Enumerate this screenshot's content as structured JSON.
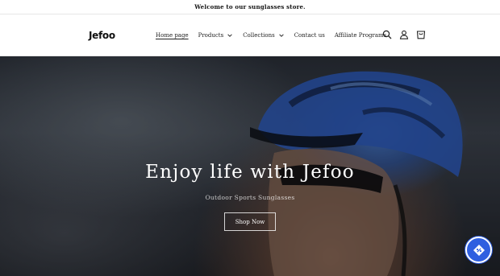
{
  "announcement": {
    "text": "Welcome to our sunglasses store."
  },
  "header": {
    "logo_text": "Jefoo",
    "nav": [
      {
        "label": "Home page",
        "active": true,
        "dropdown": false
      },
      {
        "label": "Products",
        "active": false,
        "dropdown": true
      },
      {
        "label": "Collections",
        "active": false,
        "dropdown": true
      },
      {
        "label": "Contact us",
        "active": false,
        "dropdown": false
      },
      {
        "label": "Affiliate Programs",
        "active": false,
        "dropdown": false
      }
    ],
    "icons": [
      "search-icon",
      "account-icon",
      "cart-icon"
    ]
  },
  "hero": {
    "title": "Enjoy life with Jefoo",
    "subtitle": "Outdoor Sports Sunglasses",
    "button_label": "Shop Now"
  },
  "floating_widget": {
    "icon": "discount-tag-icon",
    "color": "#2f5fe0"
  }
}
